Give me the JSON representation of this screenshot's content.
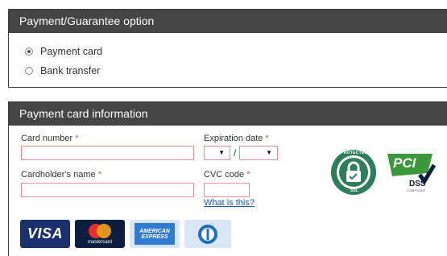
{
  "guarantee": {
    "title": "Payment/Guarantee option",
    "options": [
      {
        "label": "Payment card",
        "checked": true
      },
      {
        "label": "Bank transfer",
        "checked": false
      }
    ]
  },
  "card_info": {
    "title": "Payment card information",
    "card_number": {
      "label": "Card number",
      "value": ""
    },
    "cardholder": {
      "label": "Cardholder's name",
      "value": ""
    },
    "expiration": {
      "label": "Expiration date",
      "month": "",
      "year": "",
      "separator": "/"
    },
    "cvc": {
      "label": "CVC code",
      "value": "",
      "help_link": "What is this?"
    },
    "required_mark": "*"
  },
  "card_logos": {
    "visa": "VISA",
    "mastercard": "mastercard",
    "amex_top": "AMERICAN",
    "amex_bottom": "EXPRESS"
  },
  "badges": {
    "ssl_top": "PROTECTED",
    "ssl_bottom": "SSL",
    "pci": "PCI",
    "dss": "DSS",
    "compliant": "COMPLIANT"
  },
  "colors": {
    "header_bg": "#454545",
    "required": "#d9534f",
    "link": "#1a58b8",
    "ssl_green": "#2e7d5b",
    "pci_green": "#3a9a3a"
  }
}
